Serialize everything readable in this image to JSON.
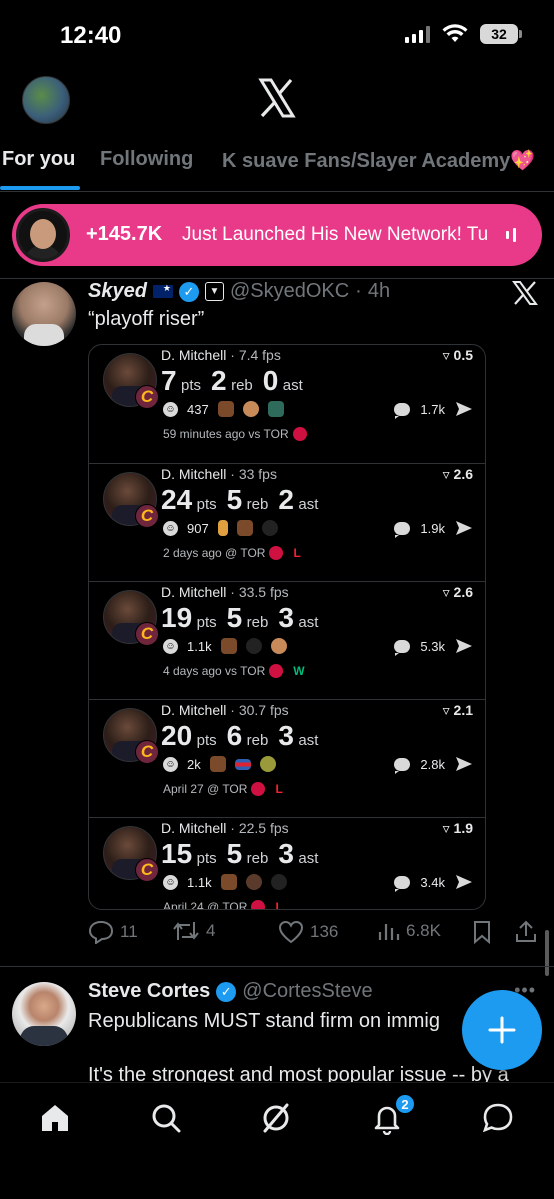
{
  "status_bar": {
    "time": "12:40",
    "battery": "32"
  },
  "tabs": [
    {
      "label": "For you"
    },
    {
      "label": "Following"
    },
    {
      "label": "K suave Fans/Slayer Academy💖"
    }
  ],
  "live_banner": {
    "count": "+145.7K",
    "text": "Just Launched His New Network! Tu"
  },
  "tweet1": {
    "name": "Skyed",
    "handle": "@SkyedOKC",
    "dot": "·",
    "time": "4h",
    "text": "“playoff riser”",
    "games": [
      {
        "player": "D. Mitchell",
        "sep": "·",
        "fps": "7.4 fps",
        "delta": "0.5",
        "pts": "7",
        "reb": "2",
        "ast": "0",
        "pts_unit": "pts",
        "reb_unit": "reb",
        "ast_unit": "ast",
        "reactions": "437",
        "replies": "1.7k",
        "meta": "59 minutes ago vs TOR",
        "result": ""
      },
      {
        "player": "D. Mitchell",
        "sep": "·",
        "fps": "33 fps",
        "delta": "2.6",
        "pts": "24",
        "reb": "5",
        "ast": "2",
        "pts_unit": "pts",
        "reb_unit": "reb",
        "ast_unit": "ast",
        "reactions": "907",
        "replies": "1.9k",
        "meta": "2 days ago @ TOR",
        "result": "L"
      },
      {
        "player": "D. Mitchell",
        "sep": "·",
        "fps": "33.5 fps",
        "delta": "2.6",
        "pts": "19",
        "reb": "5",
        "ast": "3",
        "pts_unit": "pts",
        "reb_unit": "reb",
        "ast_unit": "ast",
        "reactions": "1.1k",
        "replies": "5.3k",
        "meta": "4 days ago vs TOR",
        "result": "W"
      },
      {
        "player": "D. Mitchell",
        "sep": "·",
        "fps": "30.7 fps",
        "delta": "2.1",
        "pts": "20",
        "reb": "6",
        "ast": "3",
        "pts_unit": "pts",
        "reb_unit": "reb",
        "ast_unit": "ast",
        "reactions": "2k",
        "replies": "2.8k",
        "meta": "April 27 @ TOR",
        "result": "L"
      },
      {
        "player": "D. Mitchell",
        "sep": "·",
        "fps": "22.5 fps",
        "delta": "1.9",
        "pts": "15",
        "reb": "5",
        "ast": "3",
        "pts_unit": "pts",
        "reb_unit": "reb",
        "ast_unit": "ast",
        "reactions": "1.1k",
        "replies": "3.4k",
        "meta": "April 24 @ TOR",
        "result": "L"
      }
    ],
    "actions": {
      "replies": "11",
      "reposts": "4",
      "likes": "136",
      "views": "6.8K"
    }
  },
  "tweet2": {
    "name": "Steve Cortes",
    "handle": "@CortesSteve",
    "line1": "Republicans MUST stand firm on immig",
    "line2": "It's the strongest and most popular issue -- by a"
  },
  "bottom_nav": {
    "notifications_badge": "2"
  },
  "colors": {
    "background": "#000000",
    "accent": "#1d9bf0",
    "live_banner": "#e93a8a",
    "loss": "#f4212e",
    "win": "#00ba7c",
    "muted_text": "#71767b"
  },
  "icons": [
    "profile-avatar",
    "x-logo-icon",
    "close-x-icon",
    "verified-badge-icon",
    "reply-icon",
    "repost-icon",
    "like-icon",
    "views-icon",
    "bookmark-icon",
    "share-icon",
    "home-icon",
    "search-icon",
    "grok-icon",
    "bell-icon",
    "messages-icon",
    "compose-plus-icon"
  ]
}
